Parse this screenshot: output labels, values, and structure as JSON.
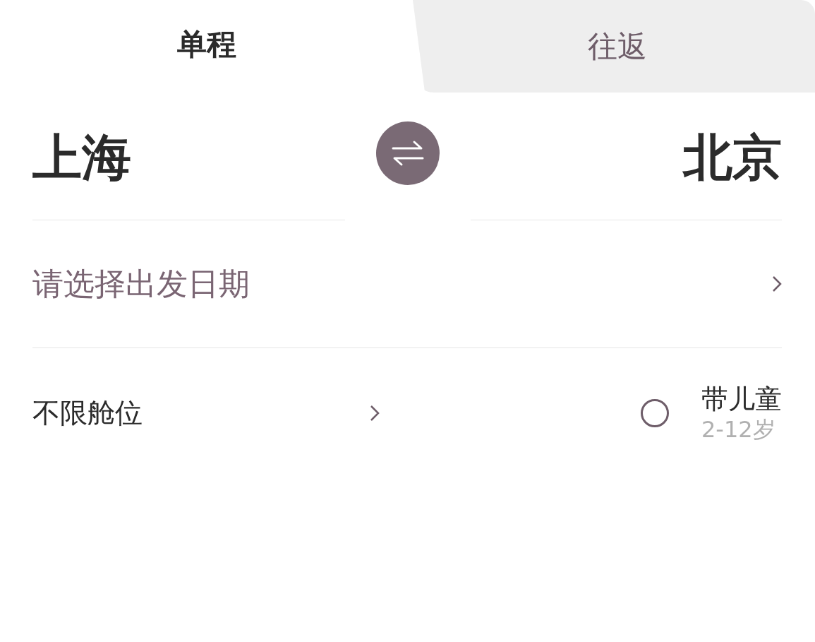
{
  "tabs": [
    {
      "label": "单程",
      "selected": true
    },
    {
      "label": "往返",
      "selected": false
    }
  ],
  "route": {
    "from": "上海",
    "to": "北京"
  },
  "date": {
    "placeholder": "请选择出发日期"
  },
  "cabin": {
    "label": "不限舱位"
  },
  "child": {
    "label": "带儿童",
    "note": "2-12岁",
    "checked": false
  }
}
